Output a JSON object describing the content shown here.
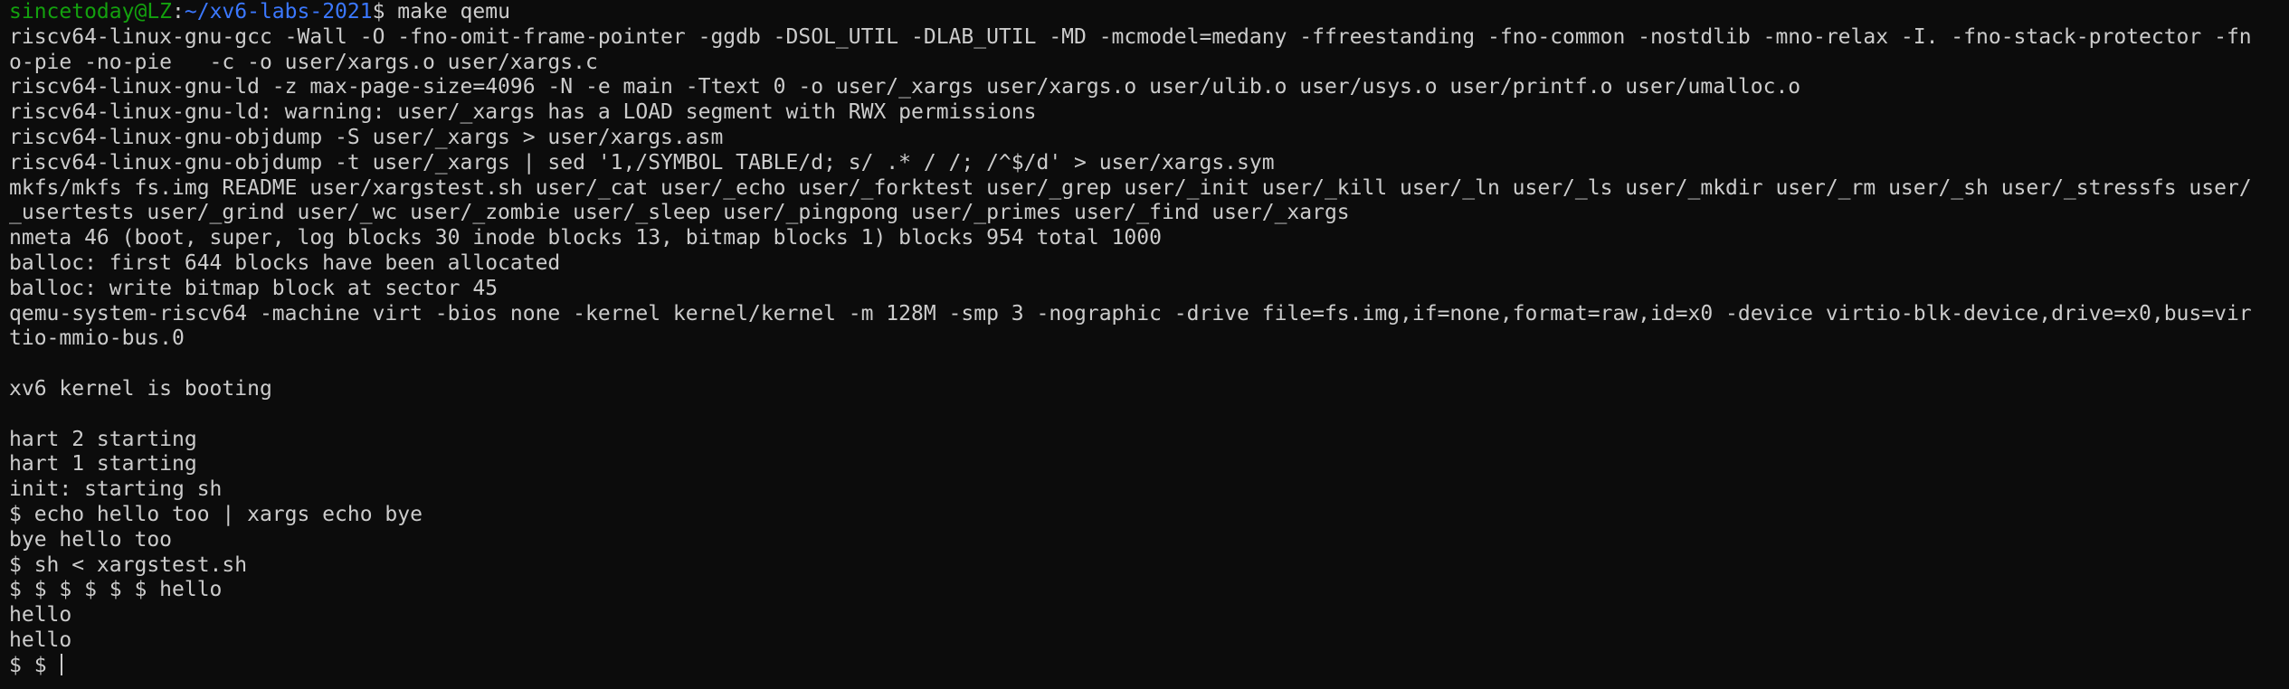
{
  "prompt": {
    "user_host": "sincetoday@LZ",
    "separator": ":",
    "path": "~/xv6-labs-2021",
    "symbol": "$ ",
    "command": "make qemu"
  },
  "output_lines": [
    "riscv64-linux-gnu-gcc -Wall -O -fno-omit-frame-pointer -ggdb -DSOL_UTIL -DLAB_UTIL -MD -mcmodel=medany -ffreestanding -fno-common -nostdlib -mno-relax -I. -fno-stack-protector -fn",
    "o-pie -no-pie   -c -o user/xargs.o user/xargs.c",
    "riscv64-linux-gnu-ld -z max-page-size=4096 -N -e main -Ttext 0 -o user/_xargs user/xargs.o user/ulib.o user/usys.o user/printf.o user/umalloc.o",
    "riscv64-linux-gnu-ld: warning: user/_xargs has a LOAD segment with RWX permissions",
    "riscv64-linux-gnu-objdump -S user/_xargs > user/xargs.asm",
    "riscv64-linux-gnu-objdump -t user/_xargs | sed '1,/SYMBOL TABLE/d; s/ .* / /; /^$/d' > user/xargs.sym",
    "mkfs/mkfs fs.img README user/xargstest.sh user/_cat user/_echo user/_forktest user/_grep user/_init user/_kill user/_ln user/_ls user/_mkdir user/_rm user/_sh user/_stressfs user/",
    "_usertests user/_grind user/_wc user/_zombie user/_sleep user/_pingpong user/_primes user/_find user/_xargs",
    "nmeta 46 (boot, super, log blocks 30 inode blocks 13, bitmap blocks 1) blocks 954 total 1000",
    "balloc: first 644 blocks have been allocated",
    "balloc: write bitmap block at sector 45",
    "qemu-system-riscv64 -machine virt -bios none -kernel kernel/kernel -m 128M -smp 3 -nographic -drive file=fs.img,if=none,format=raw,id=x0 -device virtio-blk-device,drive=x0,bus=vir",
    "tio-mmio-bus.0",
    "",
    "xv6 kernel is booting",
    "",
    "hart 2 starting",
    "hart 1 starting",
    "init: starting sh",
    "$ echo hello too | xargs echo bye",
    "bye hello too",
    "$ sh < xargstest.sh",
    "$ $ $ $ $ $ hello",
    "hello",
    "hello"
  ],
  "last_prompt": "$ $ ",
  "colors": {
    "background": "#0c0c0c",
    "foreground": "#cccccc",
    "user_host": "#13a10e",
    "path": "#3b78ff"
  }
}
